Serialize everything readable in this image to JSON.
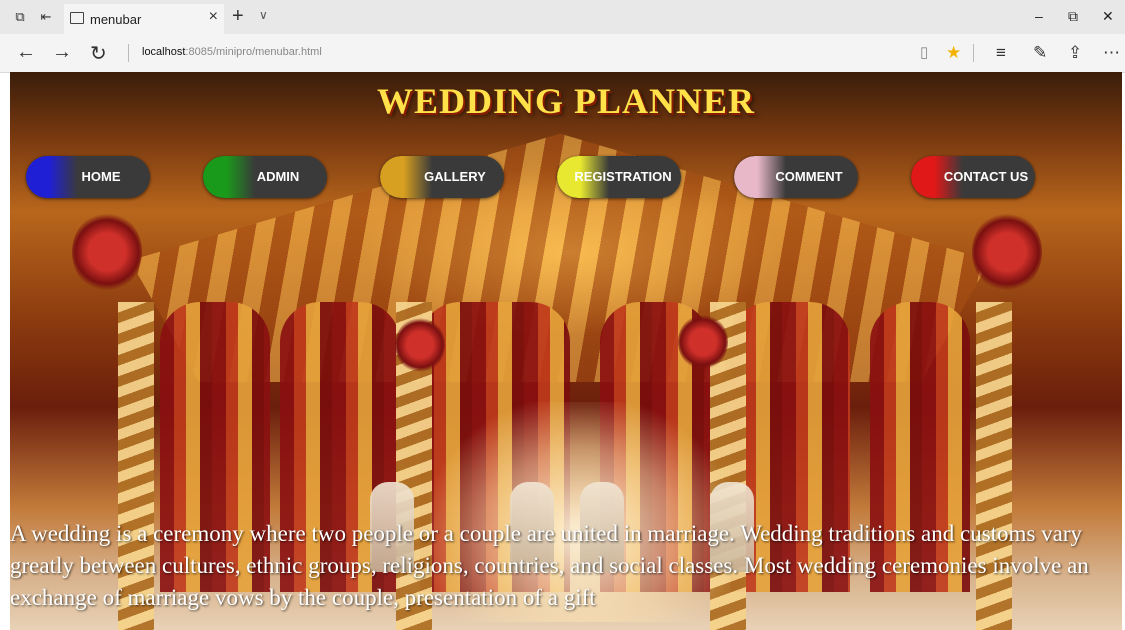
{
  "browser": {
    "tab_title": "menubar",
    "url_host": "localhost",
    "url_path": ":8085/minipro/menubar.html",
    "icons": {
      "tab_actions": "tab-actions-icon",
      "set_aside": "set-aside-icon",
      "favicon": "page-icon",
      "close_tab": "close-icon",
      "new_tab": "plus-icon",
      "tab_list": "chevron-down-icon",
      "back": "back-arrow-icon",
      "forward": "forward-arrow-icon",
      "refresh": "refresh-icon",
      "reading_view": "book-icon",
      "favorite": "star-icon",
      "hub": "hub-icon",
      "notes": "pen-icon",
      "share": "share-icon",
      "more": "more-icon",
      "minimize": "minimize-icon",
      "maximize": "restore-icon",
      "close_window": "close-icon"
    },
    "favorite_color": "#f2b400"
  },
  "page": {
    "title": "WEDDING PLANNER",
    "title_color": "#ffe14a",
    "menu": [
      {
        "label": "HOME",
        "color": "#1f1fd6"
      },
      {
        "label": "ADMIN",
        "color": "#1a9a1a"
      },
      {
        "label": "GALLERY",
        "color": "#d8a020"
      },
      {
        "label": "REGISTRATION",
        "color": "#e8e830"
      },
      {
        "label": "COMMENT",
        "color": "#e8b8c8"
      },
      {
        "label": "CONTACT US",
        "color": "#e01818"
      }
    ],
    "intro_text": "A wedding is a ceremony where two people or a couple are united in marriage. Wedding traditions and customs vary greatly between cultures, ethnic groups, religions, countries, and social classes. Most wedding ceremonies involve an exchange of marriage vows by the couple, presentation of a gift"
  }
}
